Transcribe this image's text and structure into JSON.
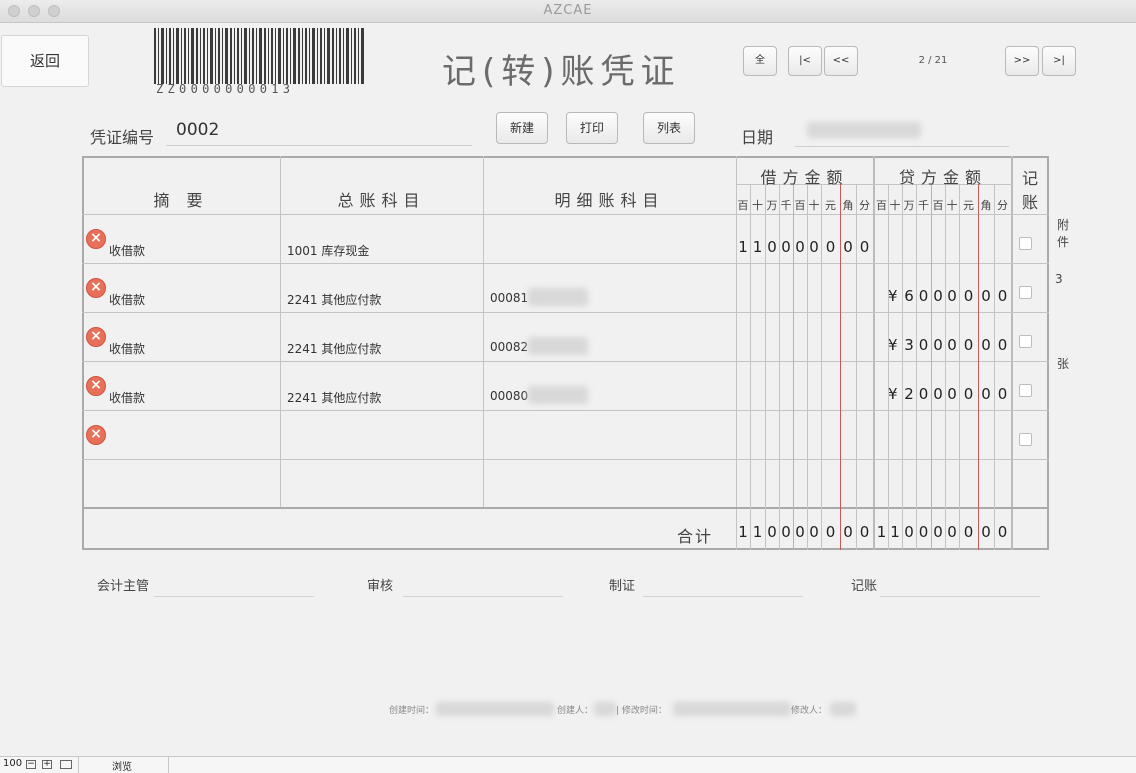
{
  "window": {
    "title": "AZCAE"
  },
  "toolbar": {
    "back_label": "返回",
    "barcode_text": "ZZ0000000013",
    "page_title": "记(转)账凭证",
    "nav_all": "全",
    "nav_first": "|<",
    "nav_prev": "<<",
    "nav_next": ">>",
    "nav_last": ">|",
    "pager": "2 / 21"
  },
  "voucher": {
    "number_label": "凭证编号",
    "number_value": "0002",
    "new_label": "新建",
    "print_label": "打印",
    "list_label": "列表",
    "date_label": "日期"
  },
  "table": {
    "headers": {
      "summary": "摘 要",
      "general_account": "总账科目",
      "detail_account": "明细账科目",
      "debit": "借方金额",
      "credit": "贷方金额",
      "posted_1": "记",
      "posted_2": "账"
    },
    "digit_units": [
      "百",
      "十",
      "万",
      "千",
      "百",
      "十",
      "元",
      "角",
      "分"
    ],
    "rows": [
      {
        "summary": "收借款",
        "account_code": "1001",
        "account_name": "库存现金",
        "detail": "",
        "debit": "¥110000000",
        "credit": ""
      },
      {
        "summary": "收借款",
        "account_code": "2241",
        "account_name": "其他应付款",
        "detail": "00081",
        "debit": "",
        "credit": "¥6000000"
      },
      {
        "summary": "收借款",
        "account_code": "2241",
        "account_name": "其他应付款",
        "detail": "00082",
        "debit": "",
        "credit": "¥3000000"
      },
      {
        "summary": "收借款",
        "account_code": "2241",
        "account_name": "其他应付款",
        "detail": "00080",
        "debit": "",
        "credit": "¥2000000"
      },
      {
        "summary": "",
        "account_code": "",
        "account_name": "",
        "detail": "",
        "debit": "",
        "credit": ""
      }
    ],
    "total_label": "合计",
    "total_debit": "¥110000000",
    "total_credit": "¥110000000"
  },
  "attachments": {
    "label_1": "附",
    "label_2": "件",
    "count": "3",
    "unit": "张"
  },
  "signatures": {
    "supervisor": "会计主管",
    "review": "审核",
    "prepared": "制证",
    "posting": "记账"
  },
  "footer": {
    "created_time": "创建时间：",
    "creator": "创建人：",
    "modified_time": "| 修改时间：",
    "modifier": "修改人："
  },
  "statusbar": {
    "zoom": "100",
    "mode": "浏览"
  }
}
